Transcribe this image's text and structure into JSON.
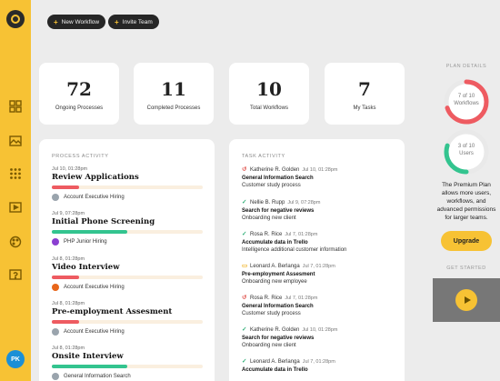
{
  "header": {
    "new_workflow": "New Workflow",
    "invite_team": "Invite Team"
  },
  "stats": [
    {
      "value": "72",
      "label": "Ongoing Processes"
    },
    {
      "value": "11",
      "label": "Completed Processes"
    },
    {
      "value": "10",
      "label": "Total Workflows"
    },
    {
      "value": "7",
      "label": "My Tasks"
    }
  ],
  "process_activity": {
    "title": "PROCESS ACTIVITY",
    "items": [
      {
        "date": "Jul 10, 01:28pm",
        "title": "Review Applications",
        "progress": 0.18,
        "bar_color": "#ee5b61",
        "meta": "Account Executive Hiring",
        "meta_icon": "user-avatar"
      },
      {
        "date": "Jul 9, 07:28pm",
        "title": "Initial Phone Screening",
        "progress": 0.5,
        "bar_color": "#33c48f",
        "meta": "PHP Junior Hiring",
        "meta_icon": "purple-dot"
      },
      {
        "date": "Jul 8, 01:28pm",
        "title": "Video Interview",
        "progress": 0.18,
        "bar_color": "#ee5b61",
        "meta": "Account Executive Hiring",
        "meta_icon": "orange-dot"
      },
      {
        "date": "Jul 8, 01:28pm",
        "title": "Pre-employment Assesment",
        "progress": 0.18,
        "bar_color": "#ee5b61",
        "meta": "Account Executive Hiring",
        "meta_icon": "user-avatar"
      },
      {
        "date": "Jul 8, 01:28pm",
        "title": "Onsite Interview",
        "progress": 0.5,
        "bar_color": "#33c48f",
        "meta": "General Information Search",
        "meta_icon": "user-avatar"
      }
    ]
  },
  "task_activity": {
    "title": "TASK ACTIVITY",
    "items": [
      {
        "icon": "undo-icon",
        "icon_glyph": "↺",
        "icon_color": "#e0554f",
        "name": "Katherine R. Golden",
        "date": "Jul 10, 01:28pm",
        "task": "General Information Search",
        "sub": "Customer study process"
      },
      {
        "icon": "check-icon",
        "icon_glyph": "✓",
        "icon_color": "#33b07a",
        "name": "Nellie B. Rupp",
        "date": "Jul 9, 07:28pm",
        "task": "Search for negative reviews",
        "sub": "Onboarding new client"
      },
      {
        "icon": "check-icon",
        "icon_glyph": "✓",
        "icon_color": "#33b07a",
        "name": "Rosa R. Rice",
        "date": "Jul 7, 01:28pm",
        "task": "Accumulate data in Trello",
        "sub": "Intelligence additional customer information"
      },
      {
        "icon": "comment-icon",
        "icon_glyph": "▭",
        "icon_color": "#f0b429",
        "name": "Leonard A. Berlanga",
        "date": "Jul 7, 01:28pm",
        "task": "Pre-employment Assesment",
        "sub": "Onboarding new employee"
      },
      {
        "icon": "undo-icon",
        "icon_glyph": "↺",
        "icon_color": "#e0554f",
        "name": "Rosa R. Rice",
        "date": "Jul 7, 01:28pm",
        "task": "General Information Search",
        "sub": "Customer study process"
      },
      {
        "icon": "check-icon",
        "icon_glyph": "✓",
        "icon_color": "#33b07a",
        "name": "Katherine R. Golden",
        "date": "Jul 10, 01:28pm",
        "task": "Search for negative reviews",
        "sub": "Onboarding new client"
      },
      {
        "icon": "check-icon",
        "icon_glyph": "✓",
        "icon_color": "#33b07a",
        "name": "Leonard A. Berlanga",
        "date": "Jul 7, 01:28pm",
        "task": "Accumulate data in Trello",
        "sub": ""
      }
    ]
  },
  "plan": {
    "title": "PLAN DETAILS",
    "workflows_used": 7,
    "workflows_total": 10,
    "workflows_label_1": "7 of 10",
    "workflows_label_2": "Workflows",
    "workflows_color": "#ee5b61",
    "users_used": 3,
    "users_total": 10,
    "users_label_1": "3 of 10",
    "users_label_2": "Users",
    "users_color": "#33c48f",
    "description": "The Premium Plan allows more users, workflows, and advanced permissions for larger teams.",
    "upgrade_label": "Upgrade",
    "get_started": "GET STARTED"
  },
  "user": {
    "initials": "PK"
  },
  "colors": {
    "accent": "#f7c234",
    "dark": "#262626"
  }
}
